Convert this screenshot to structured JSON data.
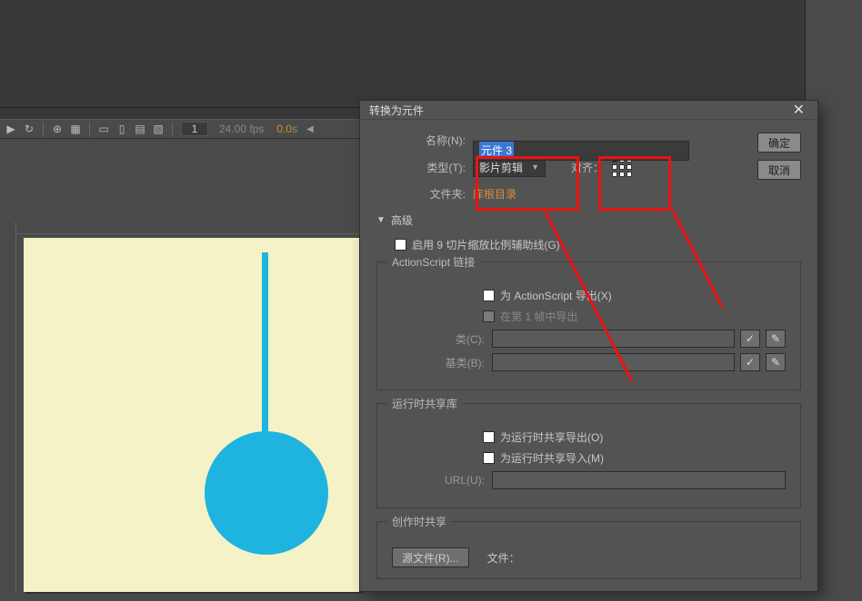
{
  "toolbar": {
    "frame": "1",
    "fps": "24.00 fps",
    "time_value": "0.0",
    "time_unit": "s"
  },
  "dialog": {
    "title": "转换为元件",
    "labels": {
      "name": "名称(N):",
      "type": "类型(T):",
      "align": "对齐：",
      "folder": "文件夹:",
      "advanced": "高级"
    },
    "name_value": "元件 3",
    "type_value": "影片剪辑",
    "folder_value": "库根目录",
    "buttons": {
      "ok": "确定",
      "cancel": "取消"
    },
    "enable_9slice": "启用 9 切片缩放比例辅助线(G)",
    "actionscript": {
      "legend": "ActionScript 链接",
      "export_as": "为 ActionScript 导出(X)",
      "export_frame1": "在第 1 帧中导出",
      "class_label": "类(C):",
      "base_class_label": "基类(B):"
    },
    "runtime_share": {
      "legend": "运行时共享库",
      "export": "为运行时共享导出(O)",
      "import": "为运行时共享导入(M)",
      "url_label": "URL(U):"
    },
    "author_share": {
      "legend": "创作时共享",
      "source_btn": "源文件(R)...",
      "file_label": "文件："
    }
  }
}
